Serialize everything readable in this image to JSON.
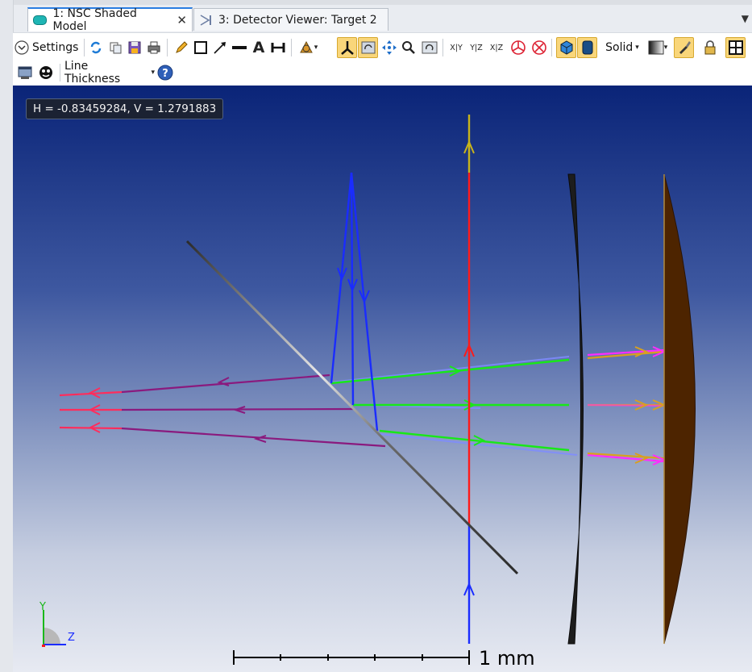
{
  "tabs": [
    {
      "label": "1: NSC Shaded Model",
      "active": true,
      "close_glyph": "✕"
    },
    {
      "label": "3: Detector Viewer: Target 2",
      "active": false
    }
  ],
  "toolbar": {
    "settings_label": "Settings",
    "solid_label": "Solid",
    "line_thickness_label": "Line Thickness",
    "dropdown_glyph": "▾",
    "axis_buttons": [
      "X|Y",
      "Y|Z",
      "X|Z"
    ]
  },
  "viewport": {
    "coords_readout": "H = -0.83459284, V = 1.2791883",
    "scale_label": "1 mm",
    "axis_labels": {
      "y": "Y",
      "z": "Z"
    }
  },
  "colors": {
    "accent": "#2a7de1",
    "ray_green": "#10e010",
    "ray_blue": "#1a2cff",
    "ray_red": "#ff1a1a",
    "ray_purple": "#7a1a7a",
    "ray_crimson": "#ff2a55",
    "lens_dark": "#1b1b1b",
    "lens_brown": "#4a2200"
  }
}
